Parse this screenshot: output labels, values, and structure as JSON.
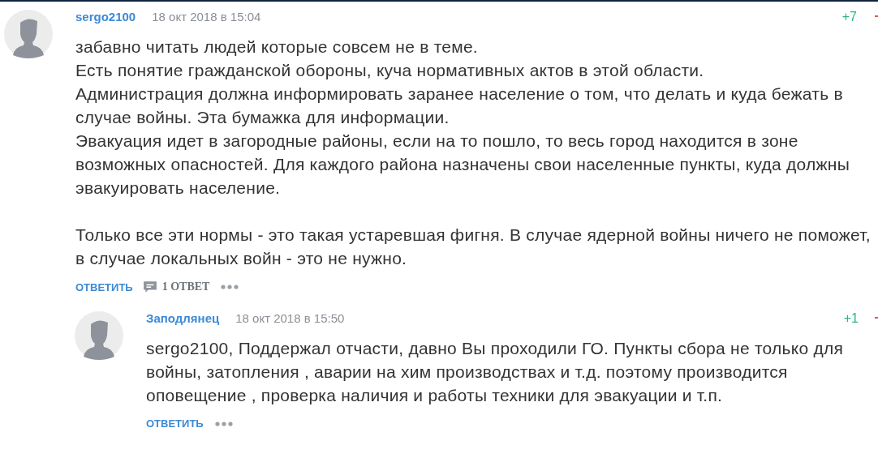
{
  "comments": [
    {
      "author": "sergo2100",
      "date": "18 окт 2018 в 15:04",
      "score": "+7",
      "paragraphs": [
        [
          "забавно читать людей которые совсем не в теме.",
          "Есть понятие гражданской обороны, куча нормативных актов в этой области.",
          "Администрация должна информировать заранее население о том, что делать и куда бежать в",
          "случае войны. Эта бумажка для информации.",
          "Эвакуация идет в загородные районы, если на то пошло, то весь город находится в зоне",
          "возможных опасностей. Для каждого района назначены свои населенные пункты, куда должны",
          "эвакуировать население."
        ],
        [
          "Только все эти нормы - это такая устаревшая фигня. В случае ядерной войны ничего не поможет,",
          "в случае локальных войн - это не нужно."
        ]
      ],
      "reply_label": "ОТВЕТИТЬ",
      "replies_count": "1 ОТВЕТ",
      "nested": false
    },
    {
      "author": "Заподлянец",
      "date": "18 окт 2018 в 15:50",
      "score": "+1",
      "paragraphs": [
        [
          "sergo2100, Поддержал отчасти, давно Вы проходили ГО. Пункты сбора не только для",
          "войны, затопления , аварии на хим производствах и т.д. поэтому производится",
          "оповещение , проверка наличия и работы техники для эвакуации и т.п."
        ]
      ],
      "reply_label": "ОТВЕТИТЬ",
      "nested": true
    }
  ]
}
